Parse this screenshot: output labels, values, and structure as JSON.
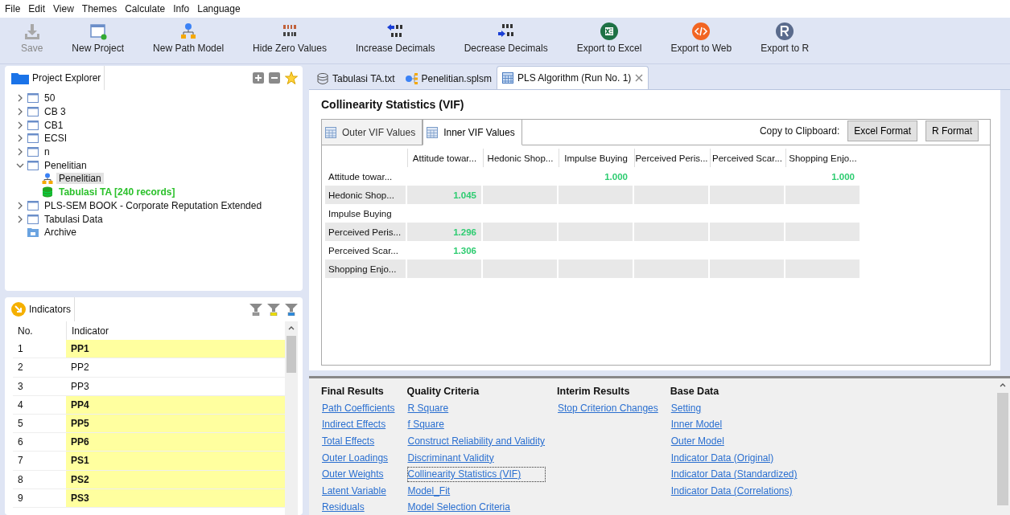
{
  "menu": [
    "File",
    "Edit",
    "View",
    "Themes",
    "Calculate",
    "Info",
    "Language"
  ],
  "toolbar": [
    {
      "label": "Save",
      "kind": "save",
      "disabled": true
    },
    {
      "label": "New Project",
      "kind": "project",
      "disabled": false
    },
    {
      "label": "New Path Model",
      "kind": "model",
      "disabled": false
    },
    {
      "label": "Hide Zero Values",
      "kind": "zero",
      "disabled": false
    },
    {
      "label": "Increase Decimals",
      "kind": "increase",
      "disabled": false
    },
    {
      "label": "Decrease Decimals",
      "kind": "decrease",
      "disabled": false
    },
    {
      "label": "Export to Excel",
      "kind": "excel",
      "disabled": false
    },
    {
      "label": "Export to Web",
      "kind": "web",
      "disabled": false
    },
    {
      "label": "Export to R",
      "kind": "r",
      "disabled": false
    }
  ],
  "project_explorer": {
    "title": "Project Explorer",
    "items": [
      {
        "label": "50",
        "kind": "project",
        "expanded": false
      },
      {
        "label": "CB 3",
        "kind": "project",
        "expanded": false
      },
      {
        "label": "CB1",
        "kind": "project",
        "expanded": false
      },
      {
        "label": "ECSI",
        "kind": "project",
        "expanded": false
      },
      {
        "label": "n",
        "kind": "project",
        "expanded": false
      },
      {
        "label": "Penelitian",
        "kind": "project",
        "expanded": true,
        "children": [
          {
            "label": "Penelitian",
            "kind": "model",
            "selected": true
          },
          {
            "label": "Tabulasi TA [240 records]",
            "kind": "data",
            "selected": false
          }
        ]
      },
      {
        "label": "PLS-SEM BOOK - Corporate Reputation Extended",
        "kind": "project",
        "expanded": false
      },
      {
        "label": "Tabulasi Data",
        "kind": "project",
        "expanded": false
      },
      {
        "label": "Archive",
        "kind": "archive"
      }
    ]
  },
  "indicators": {
    "title": "Indicators",
    "columns": [
      "No.",
      "Indicator"
    ],
    "rows": [
      {
        "no": "1",
        "name": "PP1",
        "highlighted": true
      },
      {
        "no": "2",
        "name": "PP2",
        "highlighted": false
      },
      {
        "no": "3",
        "name": "PP3",
        "highlighted": false
      },
      {
        "no": "4",
        "name": "PP4",
        "highlighted": true
      },
      {
        "no": "5",
        "name": "PP5",
        "highlighted": true
      },
      {
        "no": "6",
        "name": "PP6",
        "highlighted": true
      },
      {
        "no": "7",
        "name": "PS1",
        "highlighted": true
      },
      {
        "no": "8",
        "name": "PS2",
        "highlighted": true
      },
      {
        "no": "9",
        "name": "PS3",
        "highlighted": true
      }
    ]
  },
  "editor_tabs": [
    {
      "label": "Tabulasi TA.txt",
      "kind": "data",
      "selected": false
    },
    {
      "label": "Penelitian.splsm",
      "kind": "model",
      "selected": false
    },
    {
      "label": "PLS Algorithm (Run No. 1)",
      "kind": "table",
      "selected": true
    }
  ],
  "report": {
    "title": "Collinearity Statistics (VIF)",
    "tabs": [
      {
        "label": "Outer VIF Values",
        "selected": false
      },
      {
        "label": "Inner VIF Values",
        "selected": true
      }
    ],
    "clipboard_label": "Copy to Clipboard:",
    "clipboard_buttons": [
      "Excel Format",
      "R Format"
    ],
    "table": {
      "columns": [
        "Attitude towar...",
        "Hedonic Shop...",
        "Impulse Buying",
        "Perceived Peris...",
        "Perceived Scar...",
        "Shopping Enjo..."
      ],
      "rows": [
        {
          "label": "Attitude towar...",
          "cells": [
            null,
            null,
            "1.000",
            null,
            null,
            "1.000"
          ]
        },
        {
          "label": "Hedonic Shop...",
          "cells": [
            "1.045",
            null,
            null,
            null,
            null,
            null
          ]
        },
        {
          "label": "Impulse Buying",
          "cells": [
            null,
            null,
            null,
            null,
            null,
            null
          ]
        },
        {
          "label": "Perceived Peris...",
          "cells": [
            "1.296",
            null,
            null,
            null,
            null,
            null
          ]
        },
        {
          "label": "Perceived Scar...",
          "cells": [
            "1.306",
            null,
            null,
            null,
            null,
            null
          ]
        },
        {
          "label": "Shopping Enjo...",
          "cells": [
            null,
            null,
            null,
            null,
            null,
            null
          ]
        }
      ]
    }
  },
  "results": [
    {
      "heading": "Final Results",
      "links": [
        {
          "label": "Path Coefficients",
          "focused": false
        },
        {
          "label": "Indirect Effects",
          "focused": false
        },
        {
          "label": "Total Effects",
          "focused": false
        },
        {
          "label": "Outer Loadings",
          "focused": false
        },
        {
          "label": "Outer Weights",
          "focused": false
        },
        {
          "label": "Latent Variable",
          "focused": false
        },
        {
          "label": "Residuals",
          "focused": false
        }
      ]
    },
    {
      "heading": "Quality Criteria",
      "links": [
        {
          "label": "R Square",
          "focused": false
        },
        {
          "label": "f Square",
          "focused": false
        },
        {
          "label": "Construct Reliability and Validity",
          "focused": false
        },
        {
          "label": "Discriminant Validity",
          "focused": false
        },
        {
          "label": "Collinearity Statistics (VIF)",
          "focused": true
        },
        {
          "label": "Model_Fit",
          "focused": false
        },
        {
          "label": "Model Selection Criteria",
          "focused": false
        }
      ]
    },
    {
      "heading": "Interim Results",
      "links": [
        {
          "label": "Stop Criterion Changes",
          "focused": false
        }
      ]
    },
    {
      "heading": "Base Data",
      "links": [
        {
          "label": "Setting",
          "focused": false
        },
        {
          "label": "Inner Model",
          "focused": false
        },
        {
          "label": "Outer Model",
          "focused": false
        },
        {
          "label": "Indicator Data (Original)",
          "focused": false
        },
        {
          "label": "Indicator Data (Standardized)",
          "focused": false
        },
        {
          "label": "Indicator Data (Correlations)",
          "focused": false
        }
      ]
    }
  ]
}
